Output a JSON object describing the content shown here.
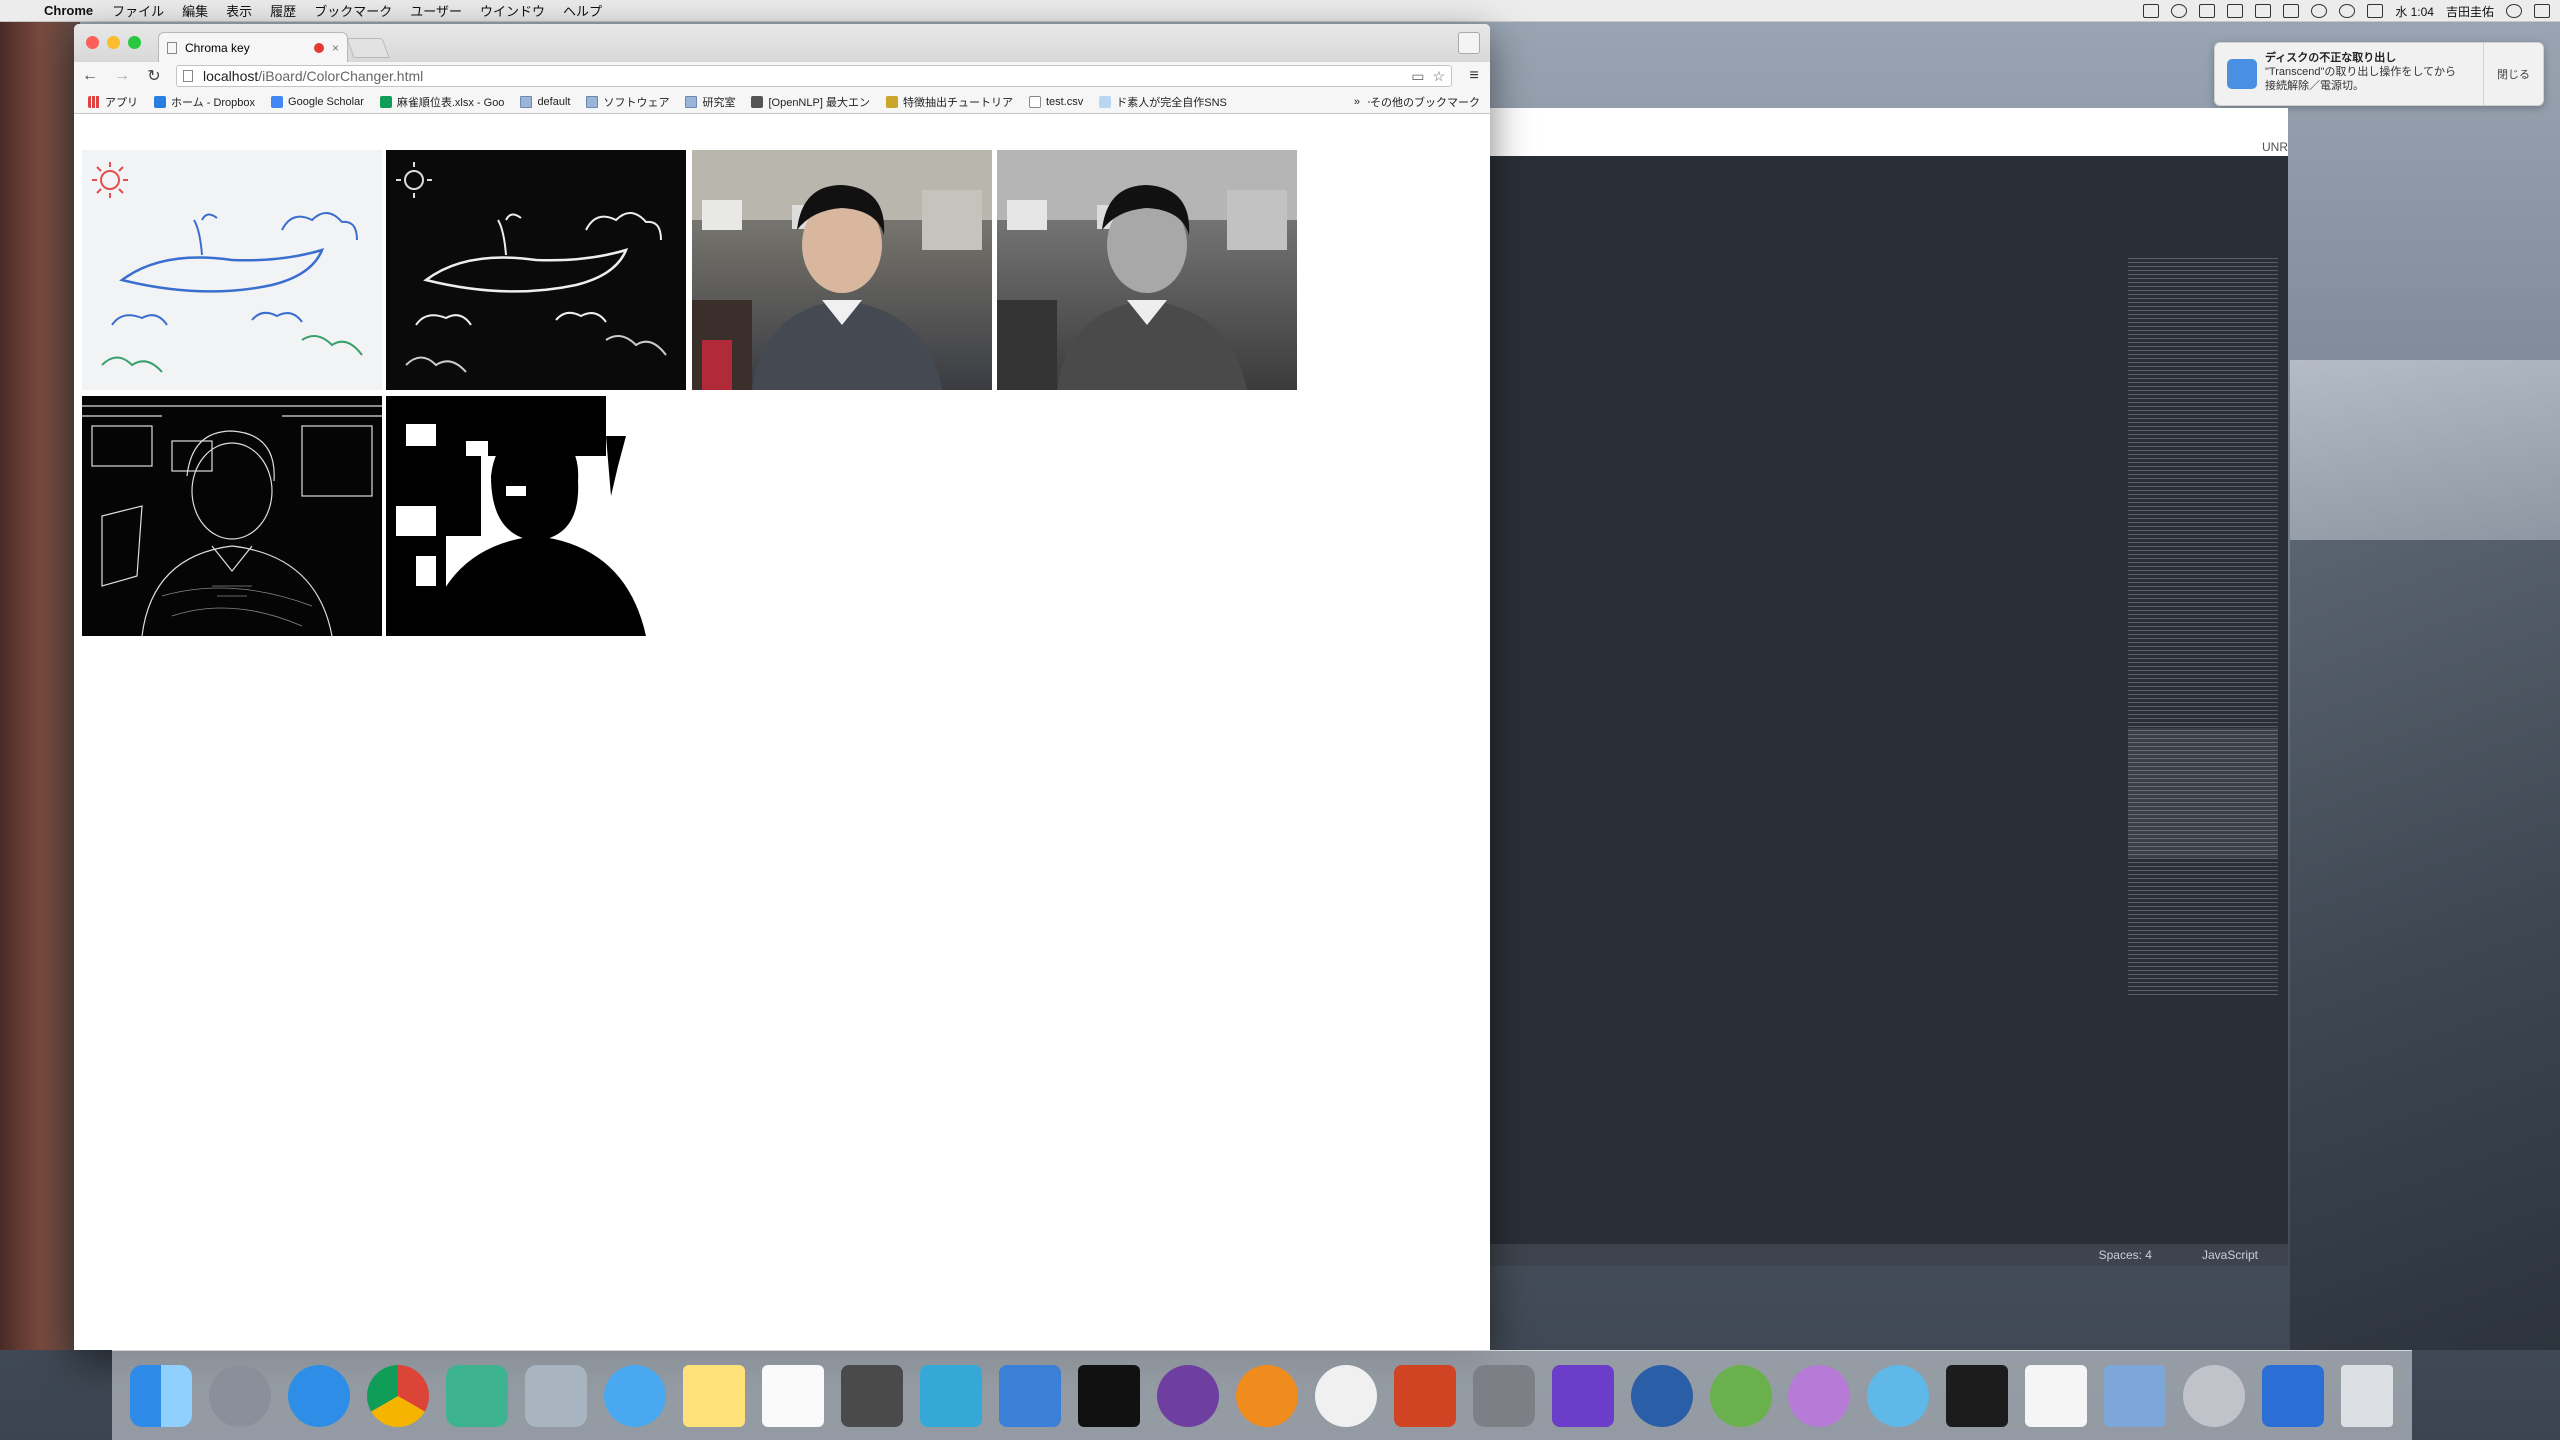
{
  "menubar": {
    "app": "Chrome",
    "items": [
      "ファイル",
      "編集",
      "表示",
      "履歴",
      "ブックマーク",
      "ユーザー",
      "ウインドウ",
      "ヘルプ"
    ],
    "clock": "水 1:04",
    "user": "吉田圭佑"
  },
  "notification": {
    "title": "ディスクの不正な取り出し",
    "body_line1": "\"Transcend\"の取り出し操作をしてから",
    "body_line2": "接続解除／電源切。",
    "close_label": "閉じる"
  },
  "browser": {
    "tab_title": "Chroma key",
    "tab_close": "×",
    "url_host": "localhost",
    "url_path": "/iBoard/ColorChanger.html",
    "bookmarks": [
      {
        "label": "アプリ",
        "icon": "apps-icon"
      },
      {
        "label": "ホーム - Dropbox",
        "icon": "dropbox-icon"
      },
      {
        "label": "Google Scholar",
        "icon": "scholar-icon"
      },
      {
        "label": "麻雀順位表.xlsx - Goo",
        "icon": "sheets-icon"
      },
      {
        "label": "default",
        "icon": "folder-icon"
      },
      {
        "label": "ソフトウェア",
        "icon": "folder-icon"
      },
      {
        "label": "研究室",
        "icon": "folder-icon"
      },
      {
        "label": "[OpenNLP] 最大エン",
        "icon": "r-icon"
      },
      {
        "label": "特徴抽出チュートリア",
        "icon": "shield-icon"
      },
      {
        "label": "test.csv",
        "icon": "file-icon"
      },
      {
        "label": "ド素人が完全自作SNS",
        "icon": "wifi-icon"
      }
    ],
    "bookmarks_more": "»",
    "bookmarks_other": "その他のブックマーク"
  },
  "editor": {
    "label_top": "UNR",
    "status_spaces": "Spaces: 4",
    "status_syntax": "JavaScript"
  },
  "dock": {
    "apps": [
      "finder-icon",
      "launchpad-icon",
      "safari-icon",
      "chrome-icon",
      "slack-icon",
      "mail-icon",
      "messages-icon",
      "notes-icon",
      "reminders-icon",
      "sublime-icon",
      "intellij-icon",
      "xcode-icon",
      "terminal-icon",
      "github-icon",
      "ibooks-icon",
      "scrivener-icon",
      "powerpoint-icon",
      "system-preferences-icon",
      "imovie-icon",
      "quicktime-icon",
      "android-studio-icon",
      "yarn-icon",
      "atom-icon",
      "activity-monitor-icon",
      "textedit-icon",
      "preview-icon",
      "disk-utility-icon",
      "word-icon",
      "trash-icon"
    ]
  }
}
